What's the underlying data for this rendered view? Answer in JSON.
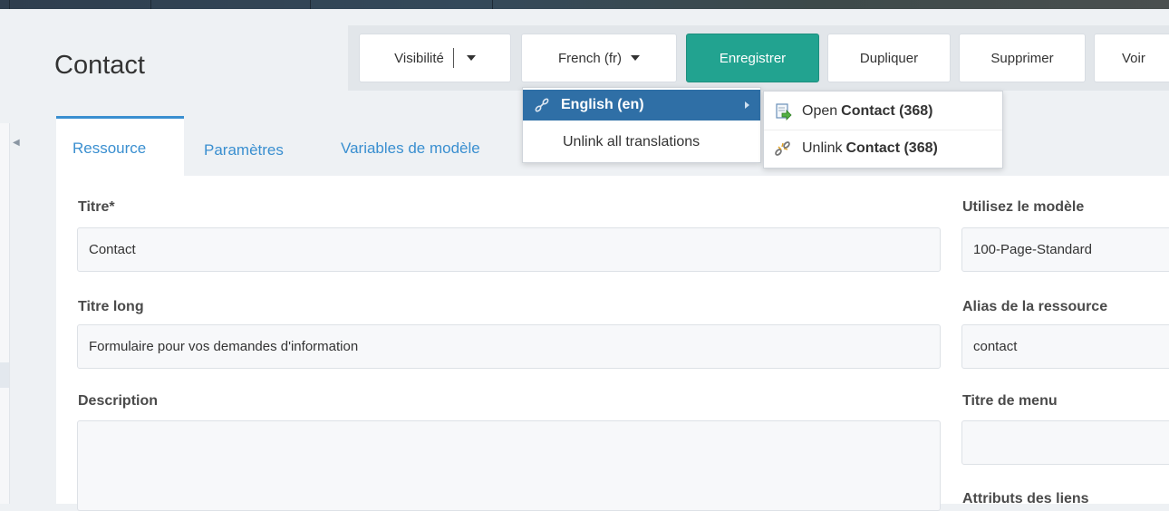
{
  "page": {
    "title": "Contact"
  },
  "actions": {
    "visibility_label": "Visibilité",
    "language_label": "French (fr)",
    "save_label": "Enregistrer",
    "duplicate_label": "Dupliquer",
    "delete_label": "Supprimer",
    "view_label": "Voir"
  },
  "language_menu": {
    "items": [
      {
        "label": "English (en)",
        "icon": "link-icon"
      },
      {
        "label": "Unlink all translations"
      }
    ],
    "submenu": {
      "open_prefix": "Open",
      "open_name": "Contact (368)",
      "unlink_prefix": "Unlink",
      "unlink_name": "Contact (368)"
    }
  },
  "tabs": [
    {
      "label": "Ressource",
      "active": true
    },
    {
      "label": "Paramètres"
    },
    {
      "label": "Variables de modèle"
    }
  ],
  "form": {
    "title_label": "Titre*",
    "title_value": "Contact",
    "longtitle_label": "Titre long",
    "longtitle_value": "Formulaire pour vos demandes d'information",
    "description_label": "Description",
    "description_value": "",
    "template_label": "Utilisez le modèle",
    "template_value": "100-Page-Standard",
    "alias_label": "Alias de la ressource",
    "alias_value": "contact",
    "menutitle_label": "Titre de menu",
    "menutitle_value": "",
    "linkattr_label": "Attributs des liens"
  },
  "colors": {
    "primary": "#22a390",
    "link": "#3a8fd0",
    "menu_highlight": "#2f6fa6"
  }
}
